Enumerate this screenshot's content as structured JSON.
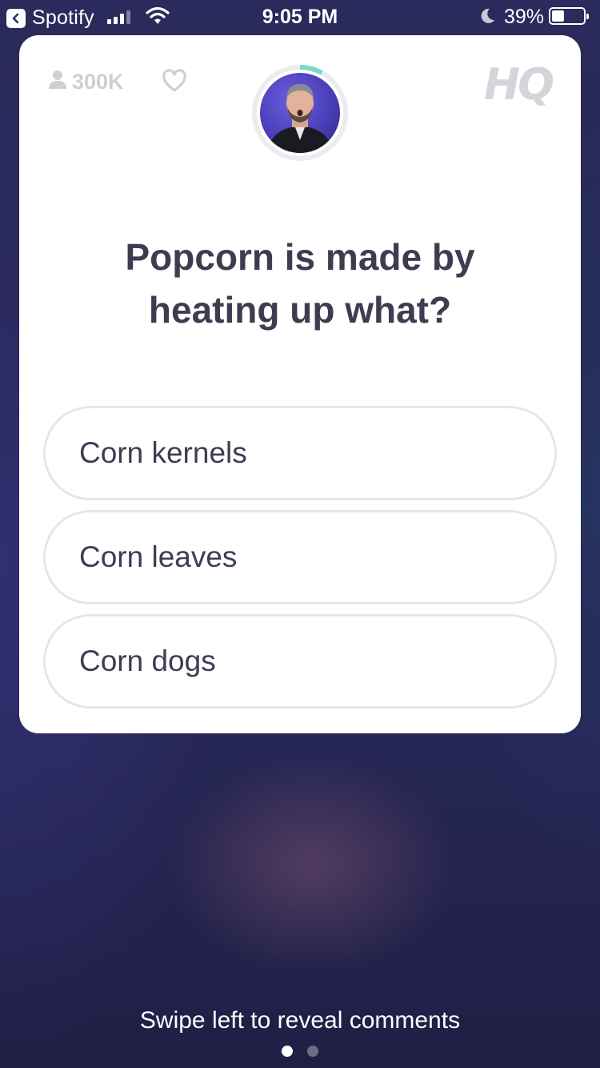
{
  "status_bar": {
    "back_app": "Spotify",
    "time": "9:05 PM",
    "battery": "39%",
    "battery_level": 0.39
  },
  "card": {
    "viewer_count": "300K",
    "logo": "HQ",
    "host_timer_progress": 0.08,
    "question": "Popcorn is made by heating up what?",
    "answers": [
      {
        "label": "Corn kernels"
      },
      {
        "label": "Corn leaves"
      },
      {
        "label": "Corn dogs"
      }
    ]
  },
  "footer": {
    "swipe_hint": "Swipe left to reveal comments",
    "pages": 2,
    "active_page": 0
  },
  "colors": {
    "accent_timer": "#7fd8d0",
    "text_dark": "#3d3d52",
    "muted": "#cfcfd6"
  }
}
